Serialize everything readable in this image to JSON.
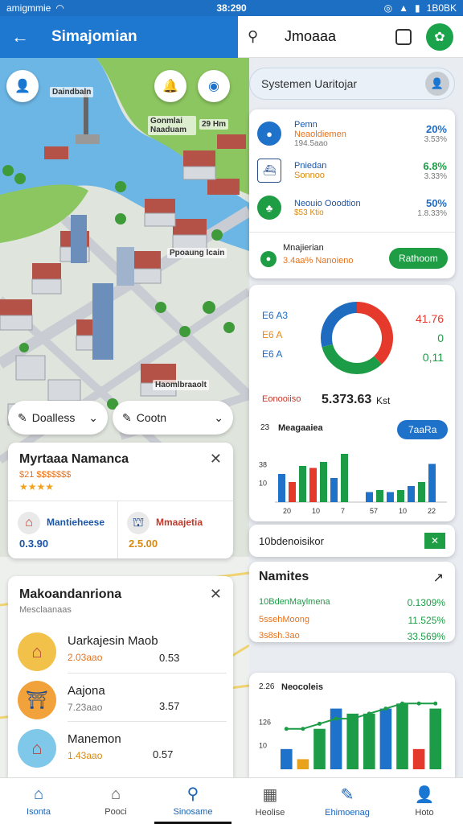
{
  "status_bar": {
    "left": "amigmmie",
    "time": "38:290",
    "battery": "1B0BK"
  },
  "header": {
    "left_title": "Simajomian",
    "right_title": "Jmoaaa"
  },
  "map": {
    "labels": [
      "Daindbaln",
      "Gonmlai Naaduam",
      "29 Hm",
      "Ppoaung lcain",
      "Haomlbraaolt"
    ]
  },
  "filters": {
    "left": "Doalless",
    "right": "Cootn"
  },
  "place_card": {
    "title": "Myrtaaa Namanca",
    "rating_text": "$21 $$$$$$$",
    "stars": "★★★★",
    "items": [
      {
        "label": "Mantieheese",
        "value": "0.3.90"
      },
      {
        "label": "Mmaajetia",
        "value": "2.5.00"
      }
    ]
  },
  "list_card": {
    "title": "Makoandanriona",
    "subtitle": "Mesclaanaas",
    "items": [
      {
        "name": "Uarkajesin Maob",
        "sub": "2.03aao",
        "value": "0.53"
      },
      {
        "name": "Aajona",
        "sub": "7.23aao",
        "value": "3.57"
      },
      {
        "name": "Manemon",
        "sub": "1.43aao",
        "value": "0.57"
      }
    ]
  },
  "right_search": {
    "placeholder": "Systemen Uaritojar"
  },
  "metrics_card": {
    "rows": [
      {
        "title": "Pemn",
        "title2": "Neaoldiemen",
        "sub": "194.5aao",
        "value": "20%",
        "value_sub": "3.53%",
        "color": "#1f72c9",
        "value_color": "#1f6bc0"
      },
      {
        "title": "Pniedan",
        "title2": "Sonnoo",
        "sub": "",
        "value": "6.8%",
        "value_sub": "3.33%",
        "color": "#2a4d8a",
        "value_color": "#1c9c46"
      },
      {
        "title": "Neouio Ooodtion",
        "title2": "",
        "sub": "$53 Ktio",
        "value": "50%",
        "value_sub": "1.8.33%",
        "color": "#1e9d44",
        "value_color": "#1f6bc0"
      }
    ],
    "footer_title": "Mnajierian",
    "footer_sub": "3.4aa% Nanoieno",
    "button": "Rathoom"
  },
  "donut_card": {
    "legend": [
      {
        "label": "E6 A3",
        "color": "#1f6bc0"
      },
      {
        "label": "E6 A",
        "color": "#e8891c"
      },
      {
        "label": "E6 A",
        "color": "#1f6bc0"
      }
    ],
    "values": [
      {
        "text": "41.76",
        "color": "#e53a2b"
      },
      {
        "text": "0",
        "color": "#1c9c46"
      },
      {
        "text": "0,11",
        "color": "#1c9c46"
      }
    ],
    "caption_left": "Eonooiiso",
    "caption_value": "5.373.63",
    "caption_unit": "Kst"
  },
  "chart_data": [
    {
      "type": "pie",
      "title": "",
      "values": [
        38,
        33,
        29
      ],
      "colors": [
        "#e53a2b",
        "#1c9c46",
        "#1f6bc0"
      ]
    },
    {
      "type": "bar",
      "title": "Meagaaiea",
      "ylabel_top": "23",
      "yticks": [
        "38",
        "10"
      ],
      "categories": [
        "20",
        "10",
        "7",
        "57",
        "10",
        "22"
      ],
      "values": [
        14,
        10,
        18,
        17,
        20,
        12,
        24,
        5,
        6,
        5,
        6,
        8,
        10,
        19
      ],
      "colors": [
        "#1f72c9",
        "#e53a2b",
        "#1c9c46",
        "#e53a2b",
        "#1c9c46",
        "#1f72c9",
        "#1c9c46",
        "#1f72c9",
        "#1c9c46",
        "#1f72c9",
        "#1c9c46",
        "#1f72c9",
        "#1c9c46",
        "#1f72c9"
      ],
      "ylim": [
        0,
        28
      ],
      "button": "7aaRa"
    },
    {
      "type": "bar",
      "title": "Neocoleis",
      "ylabel_top": "2.26",
      "yticks": [
        "126",
        "10"
      ],
      "values": [
        4,
        2,
        8,
        12,
        11,
        11,
        12,
        13,
        4,
        12
      ],
      "colors": [
        "#1f72c9",
        "#e8a21c",
        "#1c9c46",
        "#1f72c9",
        "#1c9c46",
        "#1c9c46",
        "#1f72c9",
        "#1c9c46",
        "#e53a2b",
        "#1c9c46"
      ],
      "line": [
        8,
        8,
        9,
        10,
        10,
        11,
        12,
        13,
        13,
        13
      ],
      "ylim": [
        0,
        14
      ]
    }
  ],
  "excel_card": {
    "label": "10bdenoisikor"
  },
  "trending_card": {
    "title": "Namites",
    "rows": [
      {
        "label": "10BdenMaylmena",
        "value": "0.1309%",
        "color": "#1c9c46"
      },
      {
        "label": "5ssehMoong",
        "value": "11.525%",
        "color": "#e8721c"
      },
      {
        "label": "3s8sh.3ao",
        "value": "33.569%",
        "color": "#e8721c"
      }
    ]
  },
  "nav": {
    "items": [
      {
        "label": "Isonta",
        "icon": "home-icon"
      },
      {
        "label": "Pooci",
        "icon": "house-icon"
      },
      {
        "label": "Sinosame",
        "icon": "search-icon"
      },
      {
        "label": "Heolise",
        "icon": "building-icon"
      },
      {
        "label": "Ehimoenag",
        "icon": "edit-icon"
      },
      {
        "label": "Hoto",
        "icon": "profile-icon"
      }
    ]
  }
}
